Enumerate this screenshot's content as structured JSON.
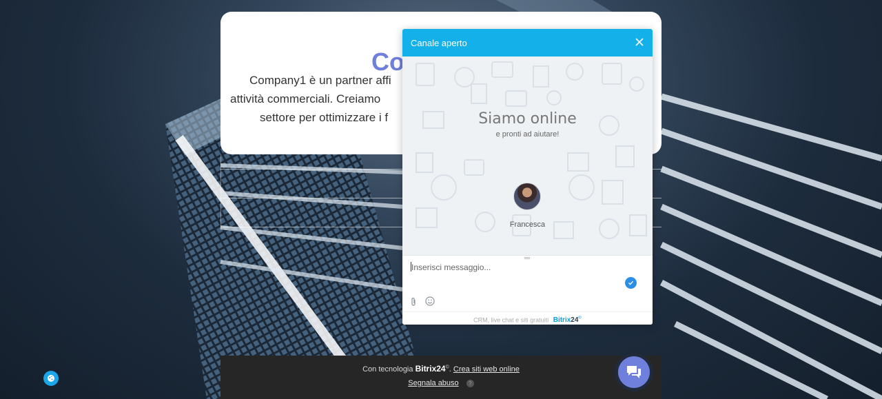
{
  "landing": {
    "title_visible": "Co",
    "desc_lines": [
      "Company1 è un partner affi",
      "attività commerciali. Creiamo",
      "settore per ottimizzare i f"
    ]
  },
  "footer": {
    "powered_prefix": "Con tecnologia",
    "brand": "Bitrix24",
    "brand_mark": "©",
    "create_link": "Crea siti web online",
    "report_link": "Segnala abuso",
    "help": "?"
  },
  "chat_widget": {
    "header_title": "Canale aperto",
    "online_title": "Siamo online",
    "online_subtitle": "e pronti ad aiutare!",
    "agent_name": "Francesca",
    "input_placeholder": "Inserisci messaggio...",
    "footer_text": "CRM, live chat e siti gratuiti",
    "footer_brand": "Bitrix",
    "footer_brand_num": "24",
    "footer_brand_mark": "©"
  },
  "icons": {
    "close": "close-icon",
    "send": "check-circle-icon",
    "attach": "paperclip-icon",
    "emoji": "smile-icon",
    "chat_fab": "chat-bubbles-icon",
    "cookie": "cookie-icon"
  },
  "colors": {
    "widget_header": "#14b0ea",
    "accent_purple": "#6f7fdc",
    "send_blue": "#2b8fe6",
    "footer_bg": "#262626",
    "cookie_blue": "#1aa6e8"
  }
}
